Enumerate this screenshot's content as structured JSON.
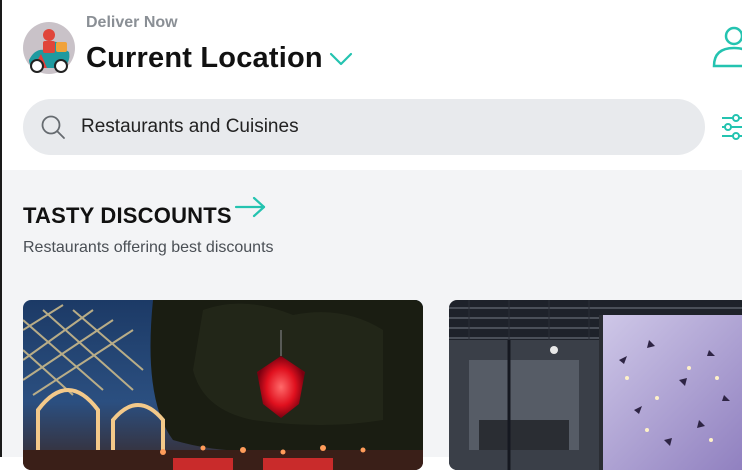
{
  "header": {
    "deliver_label": "Deliver Now",
    "location_title": "Current Location",
    "icons": {
      "logo": "delivery-rider-logo",
      "location_toggle": "chevron-down-icon",
      "profile": "user-icon"
    }
  },
  "search": {
    "placeholder": "Restaurants and Cuisines",
    "icon": "search-icon",
    "filter_icon": "sliders-icon"
  },
  "section": {
    "title": "TASTY DISCOUNTS",
    "subtitle": "Restaurants offering best discounts",
    "arrow_icon": "arrow-right-icon"
  },
  "colors": {
    "accent": "#24c3b0",
    "search_bg": "#e8eaed",
    "content_bg": "#f3f4f6",
    "muted_text": "#8a8f95"
  }
}
